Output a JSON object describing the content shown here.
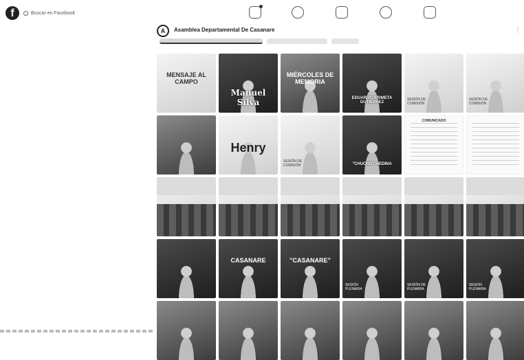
{
  "topbar": {
    "logo": "f",
    "search_placeholder": "Buscar en Facebook",
    "icons": [
      "home-icon",
      "video-icon",
      "marketplace-icon",
      "groups-icon",
      "gaming-icon"
    ]
  },
  "group": {
    "avatar_letter": "A",
    "title": "Asamblea Departamental De Casanare",
    "more": "⋮"
  },
  "tiles": [
    {
      "style": "light",
      "banner": "MENSAJE AL CAMPO"
    },
    {
      "style": "dark",
      "caption": "Manuel Silva"
    },
    {
      "style": "mid",
      "banner": "MIÉRCOLES DE MEMORIA"
    },
    {
      "style": "dark",
      "caption": "EDUARDO ARIMETA GUTIÉRREZ",
      "small": true
    },
    {
      "style": "light",
      "side": "SESIÓN DE COMISIÓN"
    },
    {
      "style": "light",
      "side": "SESIÓN DE COMISIÓN"
    },
    {
      "style": "mid"
    },
    {
      "style": "light",
      "caption": "Henry",
      "big": true,
      "dark": true
    },
    {
      "style": "light",
      "side": "SESIÓN DE COMISIÓN"
    },
    {
      "style": "dark",
      "caption": "\"CHUCHO\" MEDINA",
      "small": true
    },
    {
      "style": "white",
      "doc_title": "COMUNICADO"
    },
    {
      "style": "white",
      "doc_title": ""
    },
    {
      "style": "room"
    },
    {
      "style": "room"
    },
    {
      "style": "room"
    },
    {
      "style": "room"
    },
    {
      "style": "room"
    },
    {
      "style": "room"
    },
    {
      "style": "dark"
    },
    {
      "style": "dark",
      "banner": "CASANARE"
    },
    {
      "style": "dark",
      "banner": "\"CASANARE\""
    },
    {
      "style": "dark",
      "side": "SESIÓN PLENARIA"
    },
    {
      "style": "dark",
      "side": "SESIÓN DE PLENARIA"
    },
    {
      "style": "dark",
      "side": "SESIÓN PLENARIA"
    },
    {
      "style": "mid"
    },
    {
      "style": "mid"
    },
    {
      "style": "mid"
    },
    {
      "style": "mid"
    },
    {
      "style": "mid"
    },
    {
      "style": "mid"
    }
  ]
}
